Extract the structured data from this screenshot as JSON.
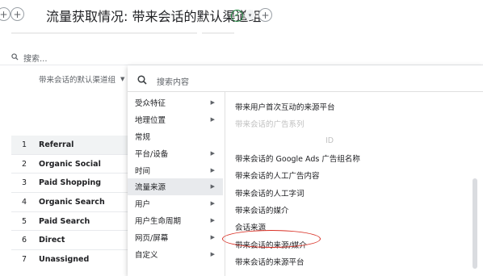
{
  "header": {
    "title": "流量获取情况: 带来会话的默认渠道组",
    "plus_glyph": "+",
    "status_color": "#188038"
  },
  "search": {
    "placeholder": "搜索..."
  },
  "dimension_selector": {
    "label": "带来会话的默认渠道组"
  },
  "table": {
    "rows": [
      {
        "index": "1",
        "channel": "Referral"
      },
      {
        "index": "2",
        "channel": "Organic Social"
      },
      {
        "index": "3",
        "channel": "Paid Shopping"
      },
      {
        "index": "4",
        "channel": "Organic Search"
      },
      {
        "index": "5",
        "channel": "Paid Search"
      },
      {
        "index": "6",
        "channel": "Direct"
      },
      {
        "index": "7",
        "channel": "Unassigned"
      }
    ]
  },
  "dropdown": {
    "search_placeholder": "搜索内容",
    "categories": [
      {
        "label": "受众特征",
        "has_submenu": true
      },
      {
        "label": "地理位置",
        "has_submenu": true
      },
      {
        "label": "常规",
        "has_submenu": false
      },
      {
        "label": "平台/设备",
        "has_submenu": true
      },
      {
        "label": "时间",
        "has_submenu": true
      },
      {
        "label": "流量来源",
        "has_submenu": true,
        "selected": true
      },
      {
        "label": "用户",
        "has_submenu": true
      },
      {
        "label": "用户生命周期",
        "has_submenu": true
      },
      {
        "label": "网页/屏幕",
        "has_submenu": true
      },
      {
        "label": "自定义",
        "has_submenu": true
      }
    ],
    "options": [
      {
        "label": "带来用户首次互动的来源平台",
        "faded": false
      },
      {
        "label": "带来会话的广告系列",
        "faded": true
      },
      {
        "label": "ID",
        "faded": true
      },
      {
        "label": "带来会话的 Google Ads 广告组名称",
        "faded": false
      },
      {
        "label": "带来会话的人工广告内容",
        "faded": false
      },
      {
        "label": "带来会话的人工字词",
        "faded": false
      },
      {
        "label": "带来会话的媒介",
        "faded": false
      },
      {
        "label": "会话来源",
        "faded": false
      },
      {
        "label": "带来会话的来源/媒介",
        "faded": false,
        "highlighted": true
      },
      {
        "label": "带来会话的来源平台",
        "faded": false
      }
    ],
    "highlight_color": "#d93025"
  }
}
